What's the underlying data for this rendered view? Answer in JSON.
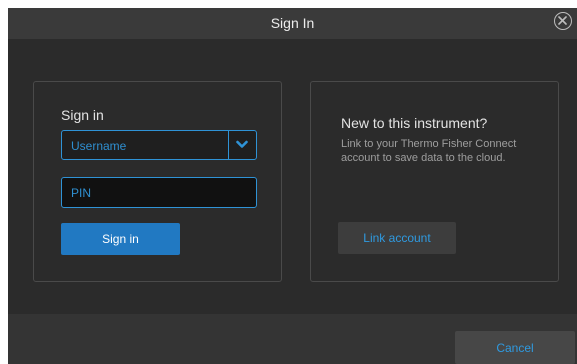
{
  "dialog": {
    "title": "Sign In",
    "close_icon": "close-circle-icon"
  },
  "sign_in_panel": {
    "heading": "Sign in",
    "username_select": {
      "selected": "Username",
      "icon": "chevron-down-icon"
    },
    "pin_input": {
      "placeholder": "PIN",
      "value": ""
    },
    "sign_in_button": "Sign in"
  },
  "link_panel": {
    "heading": "New to this instrument?",
    "description": "Link to your Thermo Fisher Connect account to save data to the cloud.",
    "link_button": "Link account"
  },
  "footer": {
    "cancel_button": "Cancel"
  },
  "colors": {
    "accent": "#2f93d6",
    "primary_button": "#2179c2",
    "background": "#2b2b2b",
    "titlebar": "#3a3a3a"
  }
}
